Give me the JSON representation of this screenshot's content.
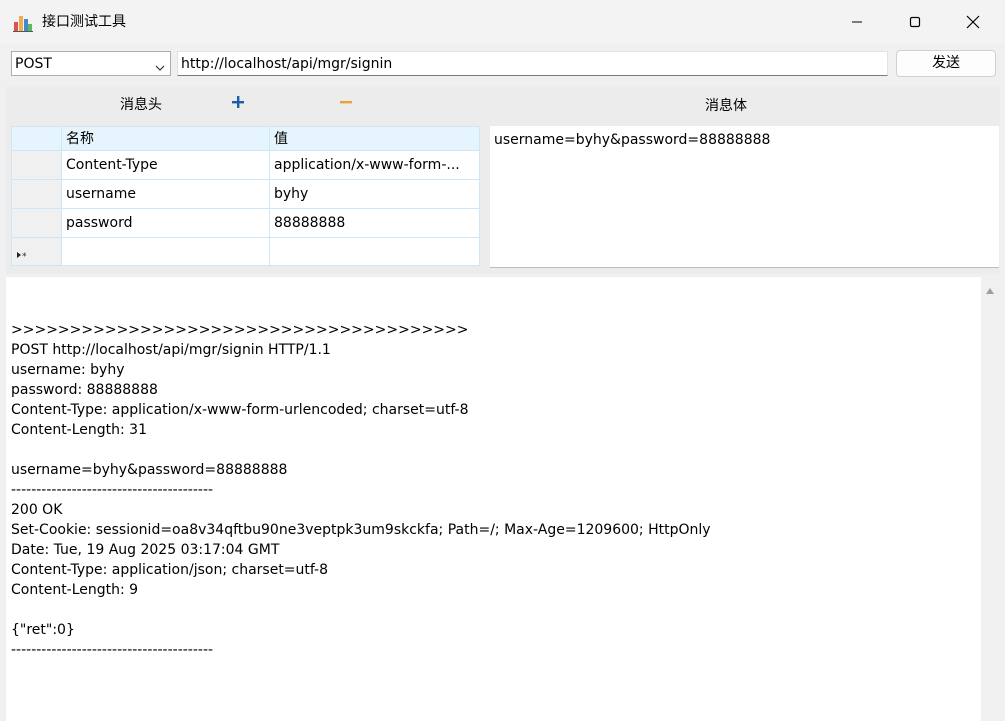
{
  "window": {
    "title": "接口测试工具"
  },
  "toolbar": {
    "method": "POST",
    "url": "http://localhost/api/mgr/signin",
    "send_label": "发送"
  },
  "headers_section": {
    "label": "消息头",
    "columns": [
      "名称",
      "值"
    ],
    "rows": [
      {
        "name": "Content-Type",
        "value": "application/x-www-form-..."
      },
      {
        "name": "username",
        "value": "byhy"
      },
      {
        "name": "password",
        "value": "88888888"
      }
    ],
    "new_row_marker": "▸*"
  },
  "body_section": {
    "label": "消息体",
    "content": "username=byhy&password=88888888"
  },
  "log": {
    "lines": [
      ">>>>>>>>>>>>>>>>>>>>>>>>>>>>>>>>>>>>>>>",
      "POST http://localhost/api/mgr/signin HTTP/1.1",
      "username: byhy",
      "password: 88888888",
      "Content-Type: application/x-www-form-urlencoded; charset=utf-8",
      "Content-Length: 31",
      "",
      "username=byhy&password=88888888",
      "----------------------------------------",
      "200 OK",
      "Set-Cookie: sessionid=oa8v34qftbu90ne3veptpk3um9skckfa; Path=/; Max-Age=1209600; HttpOnly",
      "Date: Tue, 19 Aug 2025 03:17:04 GMT",
      "Content-Type: application/json; charset=utf-8",
      "Content-Length: 9",
      "",
      "{\"ret\":0}",
      "----------------------------------------"
    ]
  },
  "colors": {
    "accent_plus": "#1a5ea8",
    "accent_minus": "#e8a23a",
    "grid_header_bg": "#e6f5fd",
    "grid_border": "#cfe6f5"
  },
  "icons": {
    "app": "bar-chart-icon",
    "minimize": "minimize-icon",
    "maximize": "maximize-icon",
    "close": "close-icon",
    "dropdown": "chevron-down-icon",
    "add": "plus-icon",
    "remove": "minus-icon",
    "scroll_up": "scroll-up-icon"
  }
}
